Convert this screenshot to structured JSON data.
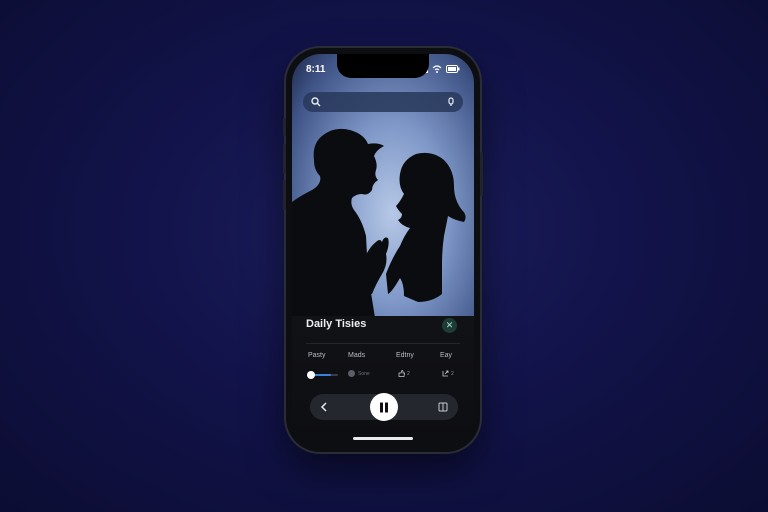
{
  "status_bar": {
    "time": "8:11"
  },
  "search": {
    "icon": "search-icon",
    "mic_icon": "mic-icon"
  },
  "card": {
    "title": "Daily Tisies",
    "close_label": "✕"
  },
  "categories": [
    {
      "label": "Pasty"
    },
    {
      "label": "Mads"
    },
    {
      "label": "Edtny"
    },
    {
      "label": "Eay"
    }
  ],
  "controls": {
    "slider_level": 0.75,
    "toggle_label": "Sone",
    "like_label": "2",
    "share_label": "2"
  },
  "player": {
    "back_icon": "chevron-left-icon",
    "pause_icon": "pause-icon",
    "queue_icon": "queue-icon"
  },
  "colors": {
    "background": "#12134a",
    "accent": "#3f7fd8",
    "close": "#1e3b35"
  }
}
